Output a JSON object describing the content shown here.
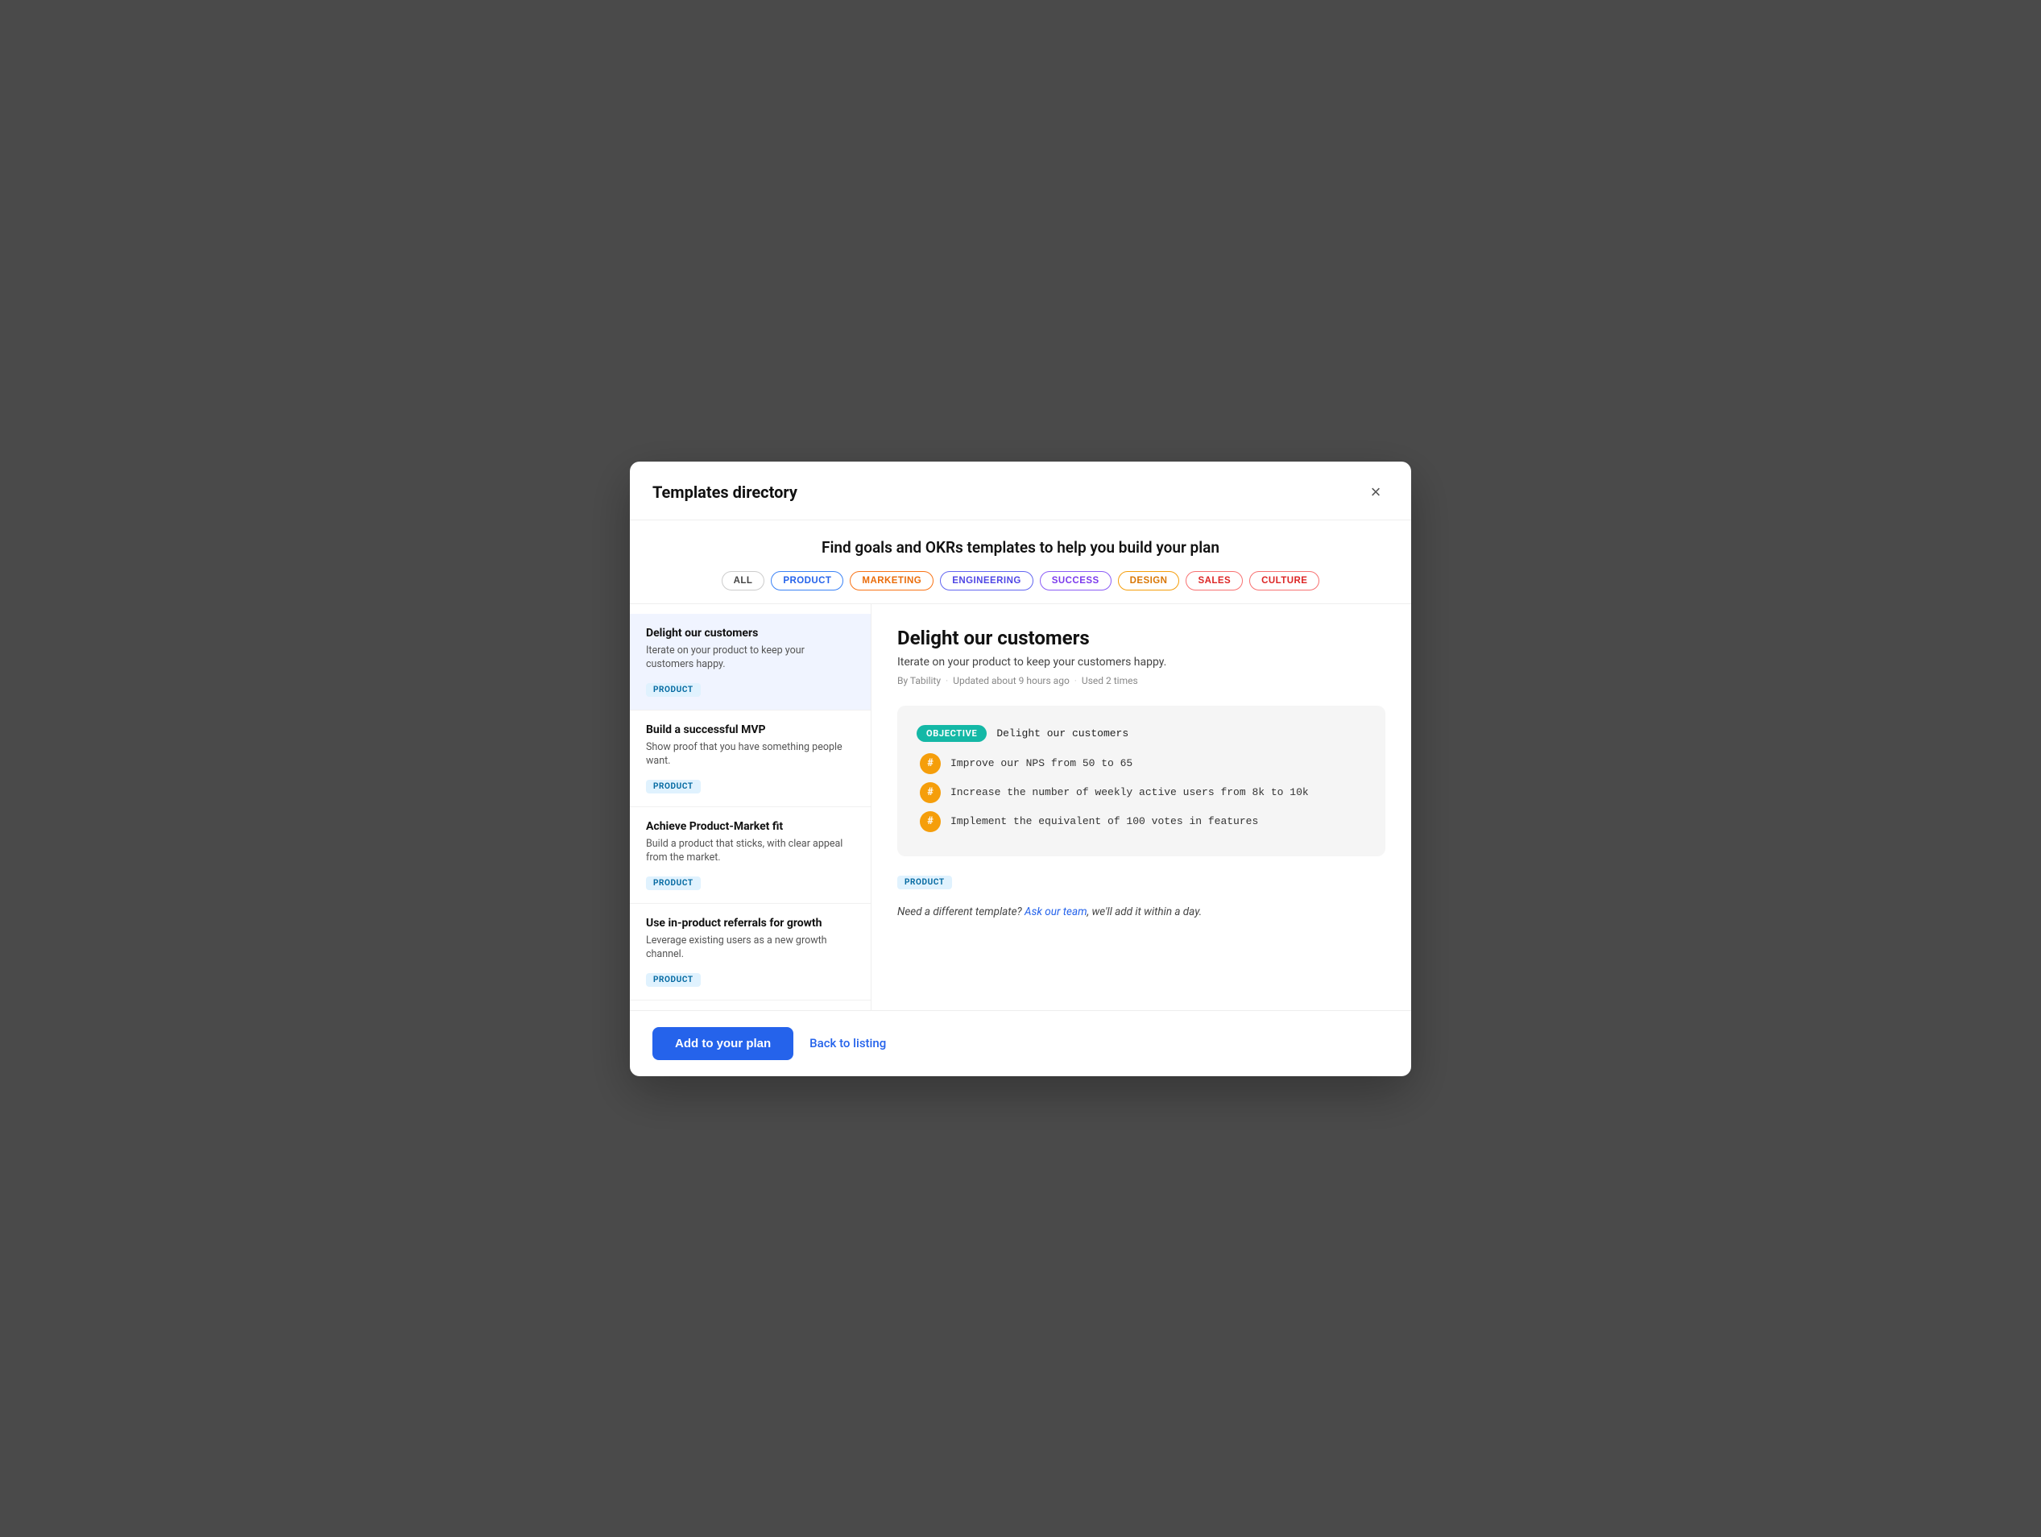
{
  "modal": {
    "title": "Templates directory",
    "close_label": "×"
  },
  "search": {
    "headline": "Find goals and OKRs templates to help you build your plan"
  },
  "filters": [
    {
      "id": "all",
      "label": "ALL",
      "class": ""
    },
    {
      "id": "product",
      "label": "PRODUCT",
      "class": "active"
    },
    {
      "id": "marketing",
      "label": "MARKETING",
      "class": "marketing"
    },
    {
      "id": "engineering",
      "label": "ENGINEERING",
      "class": "engineering"
    },
    {
      "id": "success",
      "label": "SUCCESS",
      "class": "success"
    },
    {
      "id": "design",
      "label": "DESIGN",
      "class": "design"
    },
    {
      "id": "sales",
      "label": "SALES",
      "class": "sales"
    },
    {
      "id": "culture",
      "label": "CULTURE",
      "class": "culture"
    }
  ],
  "templates": [
    {
      "id": 1,
      "title": "Delight our customers",
      "description": "Iterate on your product to keep your customers happy.",
      "badge": "PRODUCT",
      "active": true
    },
    {
      "id": 2,
      "title": "Build a successful MVP",
      "description": "Show proof that you have something people want.",
      "badge": "PRODUCT",
      "active": false
    },
    {
      "id": 3,
      "title": "Achieve Product-Market fit",
      "description": "Build a product that sticks, with clear appeal from the market.",
      "badge": "PRODUCT",
      "active": false
    },
    {
      "id": 4,
      "title": "Use in-product referrals for growth",
      "description": "Leverage existing users as a new growth channel.",
      "badge": "PRODUCT",
      "active": false
    }
  ],
  "detail": {
    "title": "Delight our customers",
    "subtitle": "Iterate on your product to keep your customers happy.",
    "meta_by": "By Tability",
    "meta_updated": "Updated about 9 hours ago",
    "meta_used": "Used 2 times",
    "objective_badge": "OBJECTIVE",
    "objective_text": "Delight our customers",
    "key_results": [
      "Improve our NPS from 50 to 65",
      "Increase the number of weekly active users from 8k to 10k",
      "Implement the equivalent of 100 votes in features"
    ],
    "kr_symbol": "#",
    "badge": "PRODUCT",
    "note_text": "Need a different template?",
    "ask_link_text": "Ask our team",
    "note_suffix": ", we'll add it within a day."
  },
  "footer": {
    "add_label": "Add to your plan",
    "back_label": "Back to listing"
  }
}
